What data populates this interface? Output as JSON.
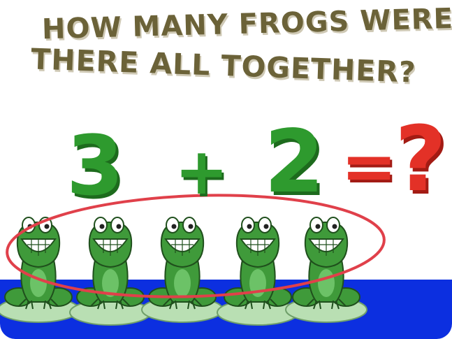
{
  "question": {
    "line1": "HOW MANY FROGS WERE",
    "line2": "THERE ALL TOGETHER?"
  },
  "equation": {
    "addend_a": "3",
    "plus": "+",
    "addend_b": "2",
    "equals": "=",
    "unknown": "?"
  },
  "frogs": {
    "count": 5
  },
  "colors": {
    "title": "#6b6238",
    "numbers": "#2e9a2e",
    "unknown": "#e33127",
    "water": "#0c2fe0",
    "lily_pad": "#b9dfb3",
    "frog": "#3f9a3a",
    "circle": "#e0404a"
  },
  "icons": [
    "frog-icon",
    "lily-pad-icon"
  ]
}
